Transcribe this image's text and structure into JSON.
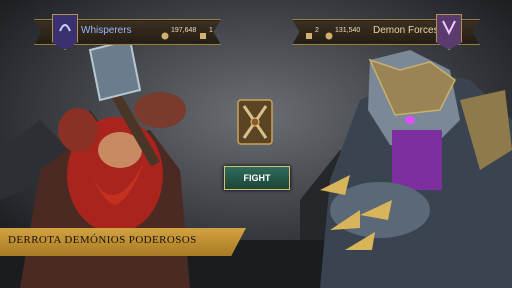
{
  "player": {
    "name": "Whisperers",
    "power": "197,648",
    "tickets": "1"
  },
  "enemy": {
    "name": "Demon Forces",
    "tickets": "2",
    "power": "131,540"
  },
  "fight_button": {
    "label": "FIGHT"
  },
  "promo_banner": {
    "text": "DERROTA DEMÓNIOS PODEROSOS"
  },
  "colors": {
    "gold": "#d3a342",
    "fight_green": "#2e6c5c",
    "player_name": "#9db4ff",
    "enemy_name": "#ecd4a8"
  }
}
